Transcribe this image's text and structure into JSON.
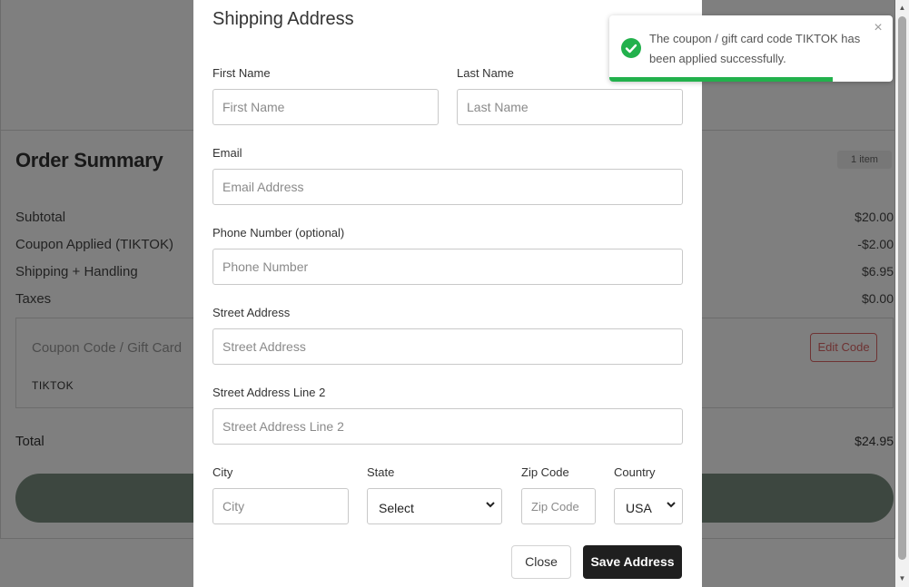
{
  "summary": {
    "title": "Order Summary",
    "item_count": "1 item",
    "rows": [
      {
        "label": "Subtotal",
        "value": "$20.00"
      },
      {
        "label": "Coupon Applied (TIKTOK)",
        "value": "-$2.00"
      },
      {
        "label": "Shipping + Handling",
        "value": "$6.95"
      },
      {
        "label": "Taxes",
        "value": "$0.00"
      }
    ],
    "coupon_label": "Coupon Code / Gift Card",
    "coupon_code": "TIKTOK",
    "edit_code_label": "Edit Code",
    "total_label": "Total",
    "total_value": "$24.95"
  },
  "modal": {
    "title": "Shipping Address",
    "first_name": {
      "label": "First Name",
      "placeholder": "First Name"
    },
    "last_name": {
      "label": "Last Name",
      "placeholder": "Last Name"
    },
    "email": {
      "label": "Email",
      "placeholder": "Email Address"
    },
    "phone": {
      "label": "Phone Number (optional)",
      "placeholder": "Phone Number"
    },
    "street": {
      "label": "Street Address",
      "placeholder": "Street Address"
    },
    "street2": {
      "label": "Street Address Line 2",
      "placeholder": "Street Address Line 2"
    },
    "city": {
      "label": "City",
      "placeholder": "City"
    },
    "state": {
      "label": "State",
      "selected": "Select"
    },
    "zip": {
      "label": "Zip Code",
      "placeholder": "Zip Code"
    },
    "country": {
      "label": "Country",
      "selected": "USA"
    },
    "close_label": "Close",
    "save_label": "Save Address"
  },
  "toast": {
    "message": "The coupon / gift card code TIKTOK has been applied successfully.",
    "close_glyph": "×",
    "icon": "check-circle-icon",
    "progress_fraction": 0.79,
    "color": "#22b14c"
  },
  "colors": {
    "checkout_button": "#7a8f81",
    "save_button": "#1f1f1f",
    "edit_code": "#dd6666"
  }
}
